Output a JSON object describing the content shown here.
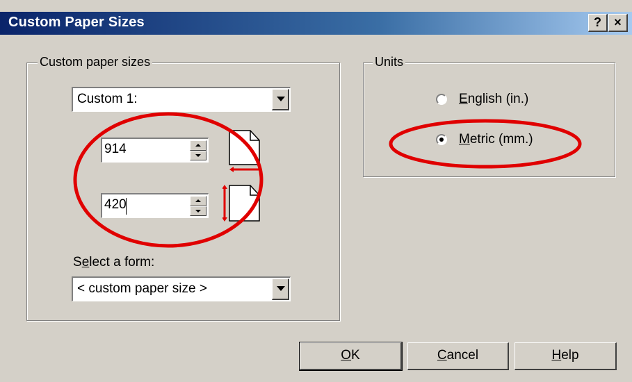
{
  "window": {
    "title": "Custom Paper Sizes",
    "help_label": "?",
    "close_label": "×"
  },
  "custom_sizes": {
    "group_label": "Custom paper sizes",
    "selected_custom": "Custom 1:",
    "width_value": "914",
    "height_value": "420",
    "select_form_label_pre": "S",
    "select_form_label_ul": "e",
    "select_form_label_post": "lect a form:",
    "selected_form": "< custom paper size >"
  },
  "units": {
    "group_label": "Units",
    "english_ul": "E",
    "english_rest": "nglish (in.)",
    "metric_ul": "M",
    "metric_rest": "etric (mm.)",
    "selected": "metric"
  },
  "buttons": {
    "ok_ul": "O",
    "ok_rest": "K",
    "cancel_ul": "C",
    "cancel_rest": "ancel",
    "help_ul": "H",
    "help_rest": "elp"
  },
  "colors": {
    "annotation": "#e00000",
    "titlebar_start": "#0a246a",
    "titlebar_end": "#a6caf0",
    "dialog_bg": "#d4d0c8"
  }
}
